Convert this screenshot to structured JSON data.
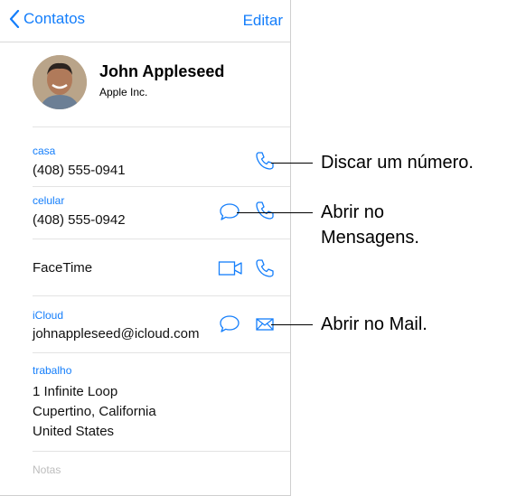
{
  "nav": {
    "back_label": "Contatos",
    "edit_label": "Editar"
  },
  "contact": {
    "name": "John Appleseed",
    "company": "Apple Inc."
  },
  "rows": {
    "home": {
      "label": "casa",
      "value": "(408) 555-0941"
    },
    "mobile": {
      "label": "celular",
      "value": "(408) 555-0942"
    },
    "facetime": {
      "value": "FaceTime"
    },
    "icloud": {
      "label": "iCloud",
      "value": "johnappleseed@icloud.com"
    },
    "work": {
      "label": "trabalho",
      "line1": "1 Infinite Loop",
      "line2": "Cupertino, California",
      "line3": "United States"
    },
    "notes": {
      "placeholder": "Notas"
    }
  },
  "callouts": {
    "dial": "Discar um número.",
    "messages_line1": "Abrir no",
    "messages_line2": "Mensagens.",
    "mail": "Abrir no Mail."
  },
  "colors": {
    "accent": "#147efb",
    "separator": "#e3e3e3"
  },
  "icons": [
    "chevron-left-icon",
    "phone-icon",
    "message-icon",
    "video-icon",
    "mail-icon"
  ]
}
